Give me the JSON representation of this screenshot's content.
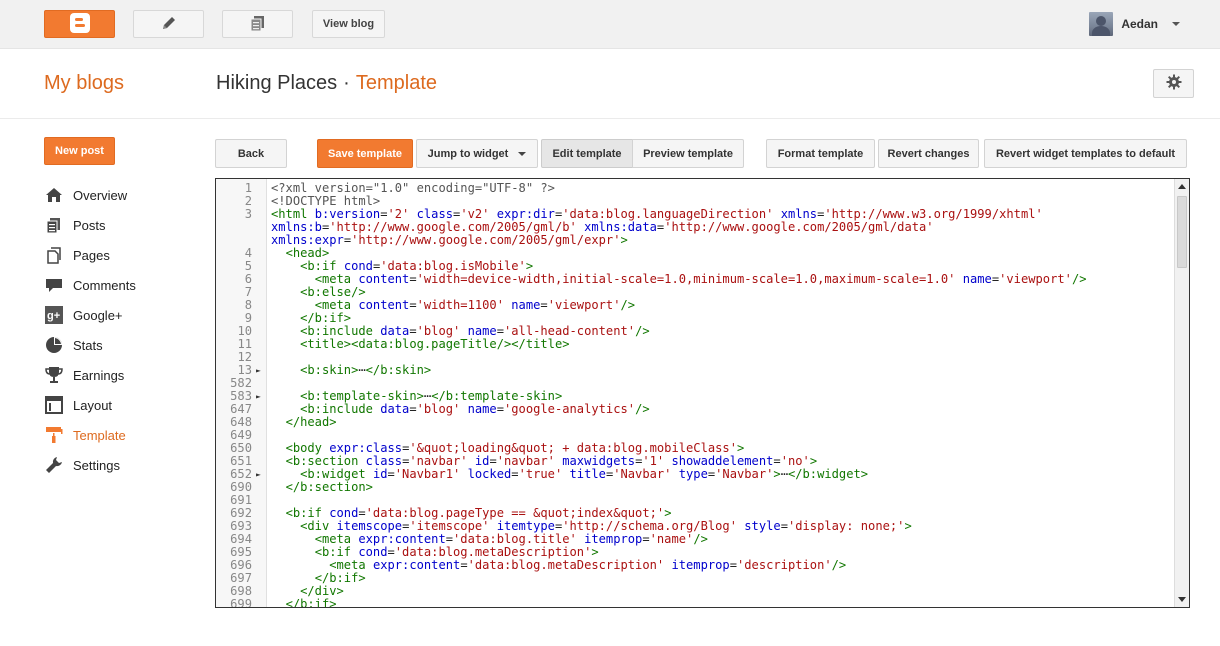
{
  "topbar": {
    "view_blog": "View blog",
    "user_name": "Aedan",
    "icons": [
      "blogger-logo-icon",
      "pencil-icon",
      "pages-icon"
    ]
  },
  "header": {
    "my_blogs": "My blogs",
    "blog_name": "Hiking Places",
    "separator": "·",
    "section": "Template"
  },
  "sidebar": {
    "new_post": "New post",
    "items": [
      {
        "label": "Overview",
        "icon": "home-icon"
      },
      {
        "label": "Posts",
        "icon": "posts-icon"
      },
      {
        "label": "Pages",
        "icon": "pages-icon"
      },
      {
        "label": "Comments",
        "icon": "comments-icon"
      },
      {
        "label": "Google+",
        "icon": "google-plus-icon"
      },
      {
        "label": "Stats",
        "icon": "stats-icon"
      },
      {
        "label": "Earnings",
        "icon": "trophy-icon"
      },
      {
        "label": "Layout",
        "icon": "layout-icon"
      },
      {
        "label": "Template",
        "icon": "template-icon"
      },
      {
        "label": "Settings",
        "icon": "wrench-icon"
      }
    ],
    "active_item": "Template"
  },
  "toolbar": {
    "back": "Back",
    "save_template": "Save template",
    "jump_to_widget": "Jump to widget",
    "edit_template": "Edit template",
    "preview_template": "Preview template",
    "format_template": "Format template",
    "revert_changes": "Revert changes",
    "revert_widget_templates": "Revert widget templates to default"
  },
  "colors": {
    "accent": "#f27a30",
    "accent_text": "#dd6a1f",
    "tag": "#117700",
    "attribute": "#0000cc",
    "string": "#aa1111"
  },
  "editor": {
    "lines": [
      {
        "n": "1",
        "fold": false,
        "html": "<span class='g'>&lt;?xml version=\"1.0\" encoding=\"UTF-8\" ?&gt;</span>"
      },
      {
        "n": "2",
        "fold": false,
        "html": "<span class='g'>&lt;!DOCTYPE html&gt;</span>"
      },
      {
        "n": "3",
        "fold": false,
        "html": "<span class='t'>&lt;html</span> <span class='a'>b:version</span>=<span class='s'>'2'</span> <span class='a'>class</span>=<span class='s'>'v2'</span> <span class='a'>expr:dir</span>=<span class='s'>'data:blog.languageDirection'</span> <span class='a'>xmlns</span>=<span class='s'>'http://www.w3.org/1999/xhtml'</span>"
      },
      {
        "n": "",
        "fold": false,
        "html": "<span class='a'>xmlns:b</span>=<span class='s'>'http://www.google.com/2005/gml/b'</span> <span class='a'>xmlns:data</span>=<span class='s'>'http://www.google.com/2005/gml/data'</span>"
      },
      {
        "n": "",
        "fold": false,
        "html": "<span class='a'>xmlns:expr</span>=<span class='s'>'http://www.google.com/2005/gml/expr'</span><span class='t'>&gt;</span>"
      },
      {
        "n": "4",
        "fold": false,
        "html": "  <span class='t'>&lt;head&gt;</span>"
      },
      {
        "n": "5",
        "fold": false,
        "html": "    <span class='t'>&lt;b:if</span> <span class='a'>cond</span>=<span class='s'>'data:blog.isMobile'</span><span class='t'>&gt;</span>"
      },
      {
        "n": "6",
        "fold": false,
        "html": "      <span class='t'>&lt;meta</span> <span class='a'>content</span>=<span class='s'>'width=device-width,initial-scale=1.0,minimum-scale=1.0,maximum-scale=1.0'</span> <span class='a'>name</span>=<span class='s'>'viewport'</span><span class='t'>/&gt;</span>"
      },
      {
        "n": "7",
        "fold": false,
        "html": "    <span class='t'>&lt;b:else/&gt;</span>"
      },
      {
        "n": "8",
        "fold": false,
        "html": "      <span class='t'>&lt;meta</span> <span class='a'>content</span>=<span class='s'>'width=1100'</span> <span class='a'>name</span>=<span class='s'>'viewport'</span><span class='t'>/&gt;</span>"
      },
      {
        "n": "9",
        "fold": false,
        "html": "    <span class='t'>&lt;/b:if&gt;</span>"
      },
      {
        "n": "10",
        "fold": false,
        "html": "    <span class='t'>&lt;b:include</span> <span class='a'>data</span>=<span class='s'>'blog'</span> <span class='a'>name</span>=<span class='s'>'all-head-content'</span><span class='t'>/&gt;</span>"
      },
      {
        "n": "11",
        "fold": false,
        "html": "    <span class='t'>&lt;title&gt;&lt;data:blog.pageTitle/&gt;&lt;/title&gt;</span>"
      },
      {
        "n": "12",
        "fold": false,
        "html": ""
      },
      {
        "n": "13",
        "fold": true,
        "html": "    <span class='t'>&lt;b:skin&gt;</span>⋯<span class='t'>&lt;/b:skin&gt;</span>"
      },
      {
        "n": "582",
        "fold": false,
        "html": ""
      },
      {
        "n": "583",
        "fold": true,
        "html": "    <span class='t'>&lt;b:template-skin&gt;</span>⋯<span class='t'>&lt;/b:template-skin&gt;</span>"
      },
      {
        "n": "647",
        "fold": false,
        "html": "    <span class='t'>&lt;b:include</span> <span class='a'>data</span>=<span class='s'>'blog'</span> <span class='a'>name</span>=<span class='s'>'google-analytics'</span><span class='t'>/&gt;</span>"
      },
      {
        "n": "648",
        "fold": false,
        "html": "  <span class='t'>&lt;/head&gt;</span>"
      },
      {
        "n": "649",
        "fold": false,
        "html": ""
      },
      {
        "n": "650",
        "fold": false,
        "html": "  <span class='t'>&lt;body</span> <span class='a'>expr:class</span>=<span class='s'>'&amp;quot;loading&amp;quot; + data:blog.mobileClass'</span><span class='t'>&gt;</span>"
      },
      {
        "n": "651",
        "fold": false,
        "html": "  <span class='t'>&lt;b:section</span> <span class='a'>class</span>=<span class='s'>'navbar'</span> <span class='a'>id</span>=<span class='s'>'navbar'</span> <span class='a'>maxwidgets</span>=<span class='s'>'1'</span> <span class='a'>showaddelement</span>=<span class='s'>'no'</span><span class='t'>&gt;</span>"
      },
      {
        "n": "652",
        "fold": true,
        "html": "    <span class='t'>&lt;b:widget</span> <span class='a'>id</span>=<span class='s'>'Navbar1'</span> <span class='a'>locked</span>=<span class='s'>'true'</span> <span class='a'>title</span>=<span class='s'>'Navbar'</span> <span class='a'>type</span>=<span class='s'>'Navbar'</span><span class='t'>&gt;</span>⋯<span class='t'>&lt;/b:widget&gt;</span>"
      },
      {
        "n": "690",
        "fold": false,
        "html": "  <span class='t'>&lt;/b:section&gt;</span>"
      },
      {
        "n": "691",
        "fold": false,
        "html": ""
      },
      {
        "n": "692",
        "fold": false,
        "html": "  <span class='t'>&lt;b:if</span> <span class='a'>cond</span>=<span class='s'>'data:blog.pageType == &amp;quot;index&amp;quot;'</span><span class='t'>&gt;</span>"
      },
      {
        "n": "693",
        "fold": false,
        "html": "    <span class='t'>&lt;div</span> <span class='a'>itemscope</span>=<span class='s'>'itemscope'</span> <span class='a'>itemtype</span>=<span class='s'>'http://schema.org/Blog'</span> <span class='a'>style</span>=<span class='s'>'display: none;'</span><span class='t'>&gt;</span>"
      },
      {
        "n": "694",
        "fold": false,
        "html": "      <span class='t'>&lt;meta</span> <span class='a'>expr:content</span>=<span class='s'>'data:blog.title'</span> <span class='a'>itemprop</span>=<span class='s'>'name'</span><span class='t'>/&gt;</span>"
      },
      {
        "n": "695",
        "fold": false,
        "html": "      <span class='t'>&lt;b:if</span> <span class='a'>cond</span>=<span class='s'>'data:blog.metaDescription'</span><span class='t'>&gt;</span>"
      },
      {
        "n": "696",
        "fold": false,
        "html": "        <span class='t'>&lt;meta</span> <span class='a'>expr:content</span>=<span class='s'>'data:blog.metaDescription'</span> <span class='a'>itemprop</span>=<span class='s'>'description'</span><span class='t'>/&gt;</span>"
      },
      {
        "n": "697",
        "fold": false,
        "html": "      <span class='t'>&lt;/b:if&gt;</span>"
      },
      {
        "n": "698",
        "fold": false,
        "html": "    <span class='t'>&lt;/div&gt;</span>"
      },
      {
        "n": "699",
        "fold": false,
        "html": "  <span class='t'>&lt;/b:if&gt;</span>"
      }
    ]
  }
}
